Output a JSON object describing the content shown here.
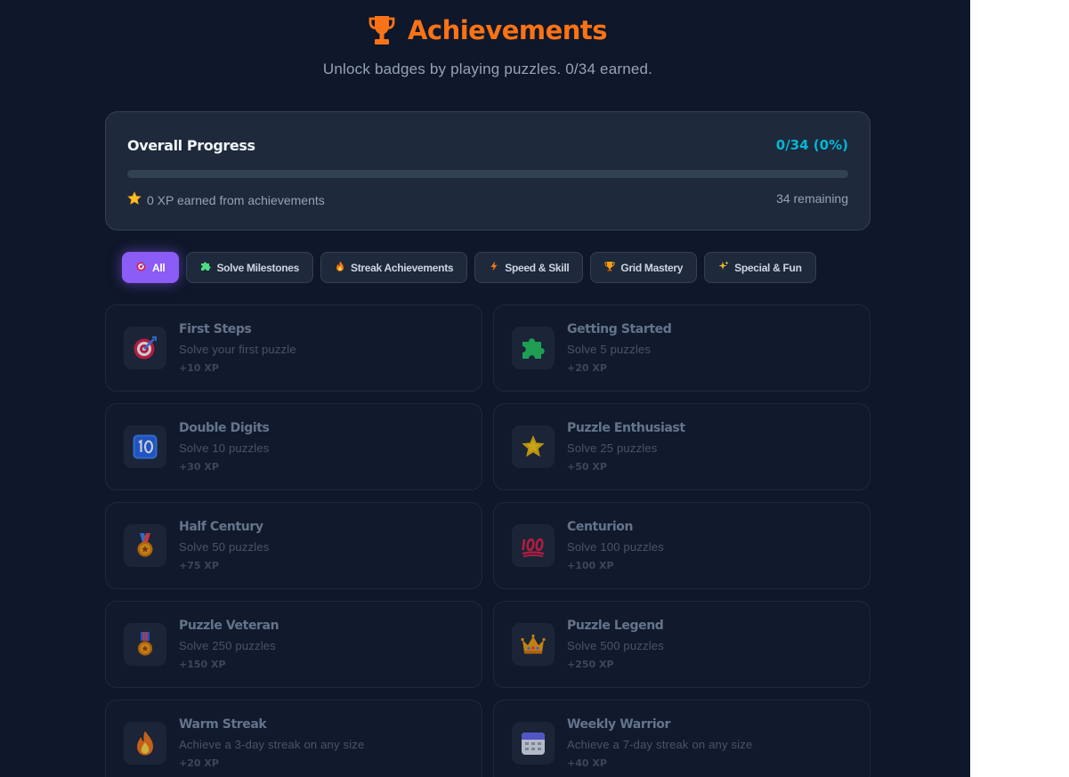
{
  "header": {
    "icon": "trophy-icon",
    "title": "Achievements",
    "subtitle": "Unlock badges by playing puzzles. 0/34 earned."
  },
  "progress": {
    "title": "Overall Progress",
    "value": "0/34 (0%)",
    "fraction": 0,
    "xp_icon": "star-icon",
    "xp_text": "0 XP earned from achievements",
    "remaining": "34 remaining"
  },
  "filters": [
    {
      "label": "All",
      "icon": "dart-icon",
      "active": true
    },
    {
      "label": "Solve Milestones",
      "icon": "puzzle-piece-icon",
      "active": false
    },
    {
      "label": "Streak Achievements",
      "icon": "fire-icon",
      "active": false
    },
    {
      "label": "Speed & Skill",
      "icon": "lightning-icon",
      "active": false
    },
    {
      "label": "Grid Mastery",
      "icon": "trophy-icon",
      "active": false
    },
    {
      "label": "Special & Fun",
      "icon": "sparkles-icon",
      "active": false
    }
  ],
  "achievements": [
    {
      "title": "First Steps",
      "desc": "Solve your first puzzle",
      "xp": "+10 XP",
      "icon": "target-icon"
    },
    {
      "title": "Getting Started",
      "desc": "Solve 5 puzzles",
      "xp": "+20 XP",
      "icon": "puzzle-piece-icon"
    },
    {
      "title": "Double Digits",
      "desc": "Solve 10 puzzles",
      "xp": "+30 XP",
      "icon": "keycap-ten-icon"
    },
    {
      "title": "Puzzle Enthusiast",
      "desc": "Solve 25 puzzles",
      "xp": "+50 XP",
      "icon": "glowing-star-icon"
    },
    {
      "title": "Half Century",
      "desc": "Solve 50 puzzles",
      "xp": "+75 XP",
      "icon": "medal-icon"
    },
    {
      "title": "Centurion",
      "desc": "Solve 100 puzzles",
      "xp": "+100 XP",
      "icon": "hundred-points-icon"
    },
    {
      "title": "Puzzle Veteran",
      "desc": "Solve 250 puzzles",
      "xp": "+150 XP",
      "icon": "military-medal-icon"
    },
    {
      "title": "Puzzle Legend",
      "desc": "Solve 500 puzzles",
      "xp": "+250 XP",
      "icon": "crown-icon"
    },
    {
      "title": "Warm Streak",
      "desc": "Achieve a 3-day streak on any size",
      "xp": "+20 XP",
      "icon": "fire-icon"
    },
    {
      "title": "Weekly Warrior",
      "desc": "Achieve a 7-day streak on any size",
      "xp": "+40 XP",
      "icon": "calendar-icon"
    }
  ],
  "colors": {
    "accent": "#f97316",
    "progress": "#06b6d4",
    "active_filter": "#8b5cf6",
    "background": "#0f172a"
  }
}
